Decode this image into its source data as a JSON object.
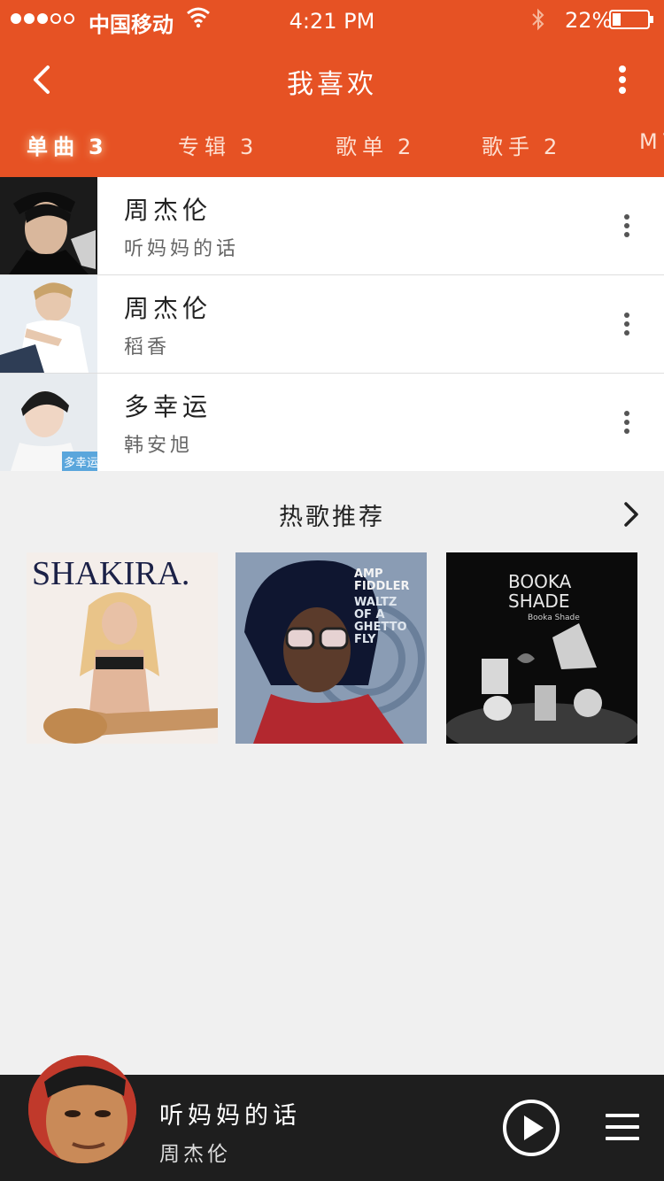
{
  "status_bar": {
    "carrier": "中国移动",
    "time": "4:21 PM",
    "battery": "22%",
    "battery_level": 0.22,
    "signal_bars": 3
  },
  "header": {
    "title": "我喜欢"
  },
  "tabs": [
    {
      "label": "单曲",
      "count": "3",
      "active": true
    },
    {
      "label": "专辑",
      "count": "3",
      "active": false
    },
    {
      "label": "歌单",
      "count": "2",
      "active": false
    },
    {
      "label": "歌手",
      "count": "2",
      "active": false
    },
    {
      "label": "MV",
      "count": "",
      "active": false
    }
  ],
  "songs": [
    {
      "name": "周杰伦",
      "sub": "听妈妈的话"
    },
    {
      "name": "周杰伦",
      "sub": "稻香"
    },
    {
      "name": "多幸运",
      "sub": "韩安旭"
    }
  ],
  "thumb_badge": "多幸运",
  "recommend": {
    "title": "热歌推荐",
    "albums": [
      {
        "cover_text": "SHAKIRA."
      },
      {
        "cover_text_lines": [
          "AMP",
          "FIDDLER",
          "WALTZ",
          "OF A",
          "GHETTO",
          "FLY"
        ]
      },
      {
        "cover_text_lines": [
          "BOOKA",
          "SHADE",
          "Booka Shade"
        ]
      }
    ]
  },
  "player": {
    "song": "听妈妈的话",
    "artist": "周杰伦"
  },
  "colors": {
    "accent": "#e65224",
    "player_bg": "#1e1e1e"
  }
}
